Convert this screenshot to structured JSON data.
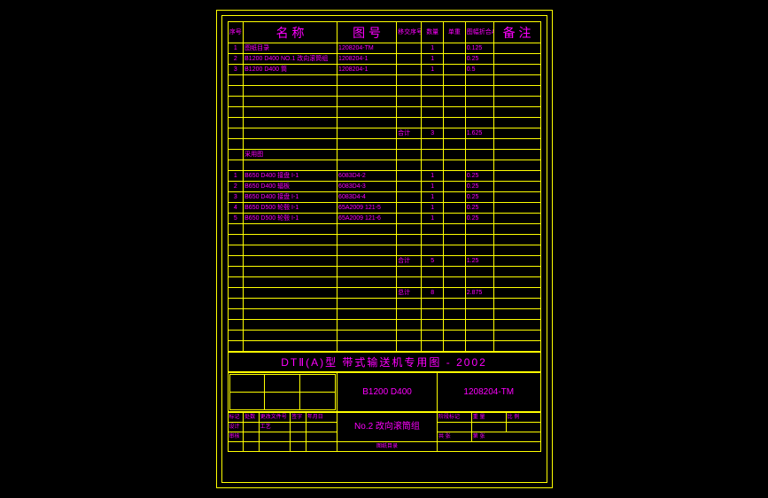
{
  "header": {
    "c0": "序号",
    "c1": "名 称",
    "c2": "图 号",
    "c3": "移交序号",
    "c4": "数量",
    "c5": "单重",
    "c6": "图幅折合A1",
    "c7": "备 注"
  },
  "rows1": [
    {
      "n": "1",
      "name": "图纸目录",
      "dwg": "1208204-TM",
      "q": "1",
      "w": "",
      "a": "0.125"
    },
    {
      "n": "2",
      "name": "B1200 D400 NO.1 改向滚筒组",
      "dwg": "1208204-1",
      "q": "1",
      "w": "",
      "a": "0.25"
    },
    {
      "n": "3",
      "name": "B1200 D400 筒",
      "dwg": "1208204-1",
      "q": "1",
      "w": "",
      "a": "0.5"
    }
  ],
  "subtotal1": {
    "label": "合计",
    "q": "3",
    "a": "1.625"
  },
  "borrow_label": "采用图",
  "rows2": [
    {
      "n": "1",
      "name": "B650 D400 接盘 I-1",
      "dwg": "6083D4-2",
      "q": "1",
      "w": "",
      "a": "0.25"
    },
    {
      "n": "2",
      "name": "B650 D400 辐板",
      "dwg": "6083D4-3",
      "q": "1",
      "w": "",
      "a": "0.25"
    },
    {
      "n": "3",
      "name": "B650 D400 接盘 I-1",
      "dwg": "6083D4-4",
      "q": "1",
      "w": "",
      "a": "0.25"
    },
    {
      "n": "4",
      "name": "B650 D500 轮毂 I-1",
      "dwg": "65A2009 121-5",
      "q": "1",
      "w": "",
      "a": "0.25"
    },
    {
      "n": "5",
      "name": "B650 D500 轮毂 I-1",
      "dwg": "65A2009 121-6",
      "q": "1",
      "w": "",
      "a": "0.25"
    }
  ],
  "subtotal2": {
    "label": "合计",
    "q": "5",
    "a": "1.25"
  },
  "total": {
    "label": "总计",
    "q": "8",
    "a": "2.875"
  },
  "title": "DTⅡ(A)型  带式输送机专用图 - 2002",
  "spec": "B1200  D400",
  "code": "1208204-TM",
  "assembly": "No.2 改向滚筒组",
  "block": {
    "r1c0": "标记",
    "r1c1": "处数",
    "r1c2": "更改文件号",
    "r1c3": "签字",
    "r1c4": "年月日",
    "r2c0": "设计",
    "r2c2": "工艺",
    "r3c0": "审核",
    "foot": "图纸目录",
    "stage": "阶段标记",
    "wt": "重 量",
    "scale": "比 例",
    "sh": "共  张",
    "pg": "第  张"
  }
}
